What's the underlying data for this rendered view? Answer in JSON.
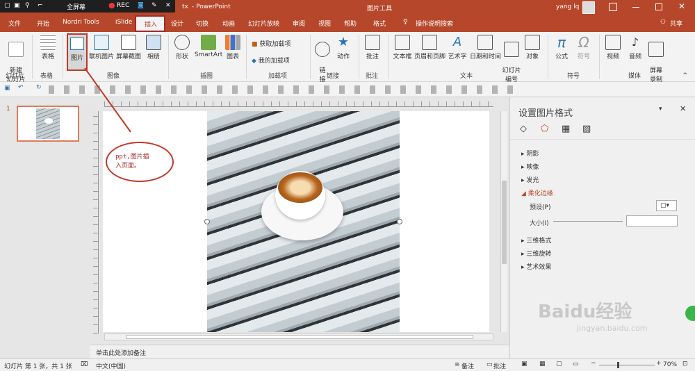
{
  "title_bar": {
    "filename_tail": "tx",
    "app": "- PowerPoint",
    "context_tool": "图片工具",
    "user": "yang lq"
  },
  "recorder": {
    "fullscreen": "全屏幕",
    "rec": "REC"
  },
  "tabs": [
    "文件",
    "开始",
    "Nordri Tools",
    "iSlide",
    "插入",
    "设计",
    "切换",
    "动画",
    "幻灯片放映",
    "审阅",
    "视图",
    "帮助",
    "格式"
  ],
  "tell_me": "操作说明搜索",
  "share": "共享",
  "ribbon": {
    "new_slide": "新建\n幻灯片",
    "table": "表格",
    "picture": "图片",
    "online_picture": "联机图片",
    "screenshot": "屏幕截图",
    "album": "相册",
    "shapes": "形状",
    "smartart": "SmartArt",
    "chart": "图表",
    "get_addins": "获取加载项",
    "my_addins": "我的加载项",
    "link": "链\n接",
    "action": "动作",
    "comment": "批注",
    "textbox": "文本框",
    "header_footer": "页眉和页脚",
    "wordart": "艺术字",
    "datetime": "日期和时间",
    "slide_number": "幻灯片\n编号",
    "object": "对象",
    "equation": "公式",
    "symbol": "符号",
    "video": "视频",
    "audio": "音频",
    "screen_record": "屏幕\n录制",
    "groups": [
      "幻灯片",
      "表格",
      "图像",
      "插图",
      "加载项",
      "链接",
      "批注",
      "文本",
      "符号",
      "媒体"
    ]
  },
  "annotation_text": "ppt,图片插\n入页面。",
  "slide_number": "1",
  "notes_placeholder": "单击此处添加备注",
  "format_pane": {
    "title": "设置图片格式",
    "sections": [
      "阴影",
      "映像",
      "发光",
      "柔化边缘",
      "三维格式",
      "三维旋转",
      "艺术效果"
    ],
    "preset_label": "预设(P)",
    "size_label": "大小(I)"
  },
  "status": {
    "slide_info": "幻灯片 第 1 张，共 1 张",
    "language": "中文(中国)",
    "notes": "备注",
    "comments": "批注",
    "zoom": "70%"
  },
  "watermark": {
    "logo_text": "Baidu经验",
    "url": "jingyan.baidu.com"
  },
  "colors": {
    "accent": "#b7472a",
    "highlight_box": "#c0392b"
  }
}
